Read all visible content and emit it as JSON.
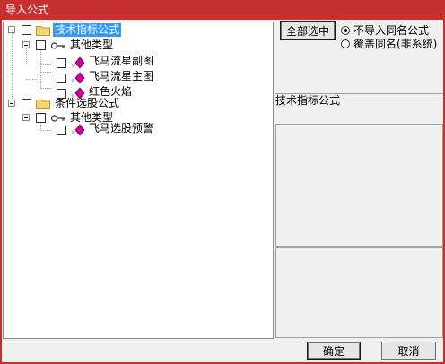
{
  "window": {
    "title": "导入公式"
  },
  "tree": {
    "nodes": [
      {
        "label": "技术指标公式",
        "selected": true,
        "checked": false
      },
      {
        "label": "其他类型",
        "checked": false
      },
      {
        "label": "飞马流星副图",
        "checked": false
      },
      {
        "label": "飞马流星主图",
        "checked": false
      },
      {
        "label": "红色火焰",
        "checked": false
      },
      {
        "label": "条件选股公式",
        "checked": false
      },
      {
        "label": "其他类型",
        "checked": false
      },
      {
        "label": "飞马选股预警",
        "checked": false
      }
    ]
  },
  "options": {
    "select_all_label": "全部选中",
    "radio_skip_label": "不导入同名公式",
    "radio_overwrite_label": "覆盖同名(非系统)",
    "selected": "skip"
  },
  "info": {
    "label": "技术指标公式"
  },
  "buttons": {
    "ok_label": "确定",
    "cancel_label": "取消"
  },
  "colors": {
    "titlebar": "#c8302f",
    "selection": "#3399ff",
    "formula_icon": "#cc0099",
    "folder_icon": "#f5d76e"
  },
  "icons": {
    "folder": "folder-icon",
    "category": "key-icon",
    "formula": "formula-icon"
  }
}
